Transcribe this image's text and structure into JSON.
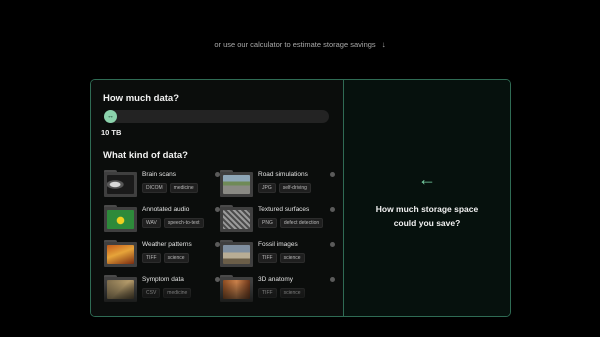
{
  "intro": {
    "text": "or use our calculator to estimate storage savings",
    "arrow": "↓"
  },
  "calculator": {
    "amount_heading": "How much data?",
    "slider_icon": "↔",
    "amount_value": "10 TB",
    "slider_fraction": 0.0,
    "kind_heading": "What kind of data?",
    "items": [
      {
        "name": "Brain scans",
        "tags": [
          "DICOM",
          "medicine"
        ],
        "icon": "brain-scan-thumbnail"
      },
      {
        "name": "Road simulations",
        "tags": [
          "JPG",
          "self-driving"
        ],
        "icon": "road-simulation-thumbnail"
      },
      {
        "name": "Annotated audio",
        "tags": [
          "WAV",
          "speech-to-text"
        ],
        "icon": "audio-thumbnail"
      },
      {
        "name": "Textured surfaces",
        "tags": [
          "PNG",
          "defect detection"
        ],
        "icon": "texture-thumbnail"
      },
      {
        "name": "Weather patterns",
        "tags": [
          "TIFF",
          "science"
        ],
        "icon": "weather-thumbnail"
      },
      {
        "name": "Fossil images",
        "tags": [
          "TIFF",
          "science"
        ],
        "icon": "fossil-thumbnail"
      },
      {
        "name": "Symptom data",
        "tags": [
          "CSV",
          "medicine"
        ],
        "icon": "symptom-thumbnail"
      },
      {
        "name": "3D anatomy",
        "tags": [
          "TIFF",
          "science"
        ],
        "icon": "anatomy-thumbnail"
      }
    ],
    "result": {
      "arrow": "←",
      "question": "How much storage space could you save?"
    }
  }
}
